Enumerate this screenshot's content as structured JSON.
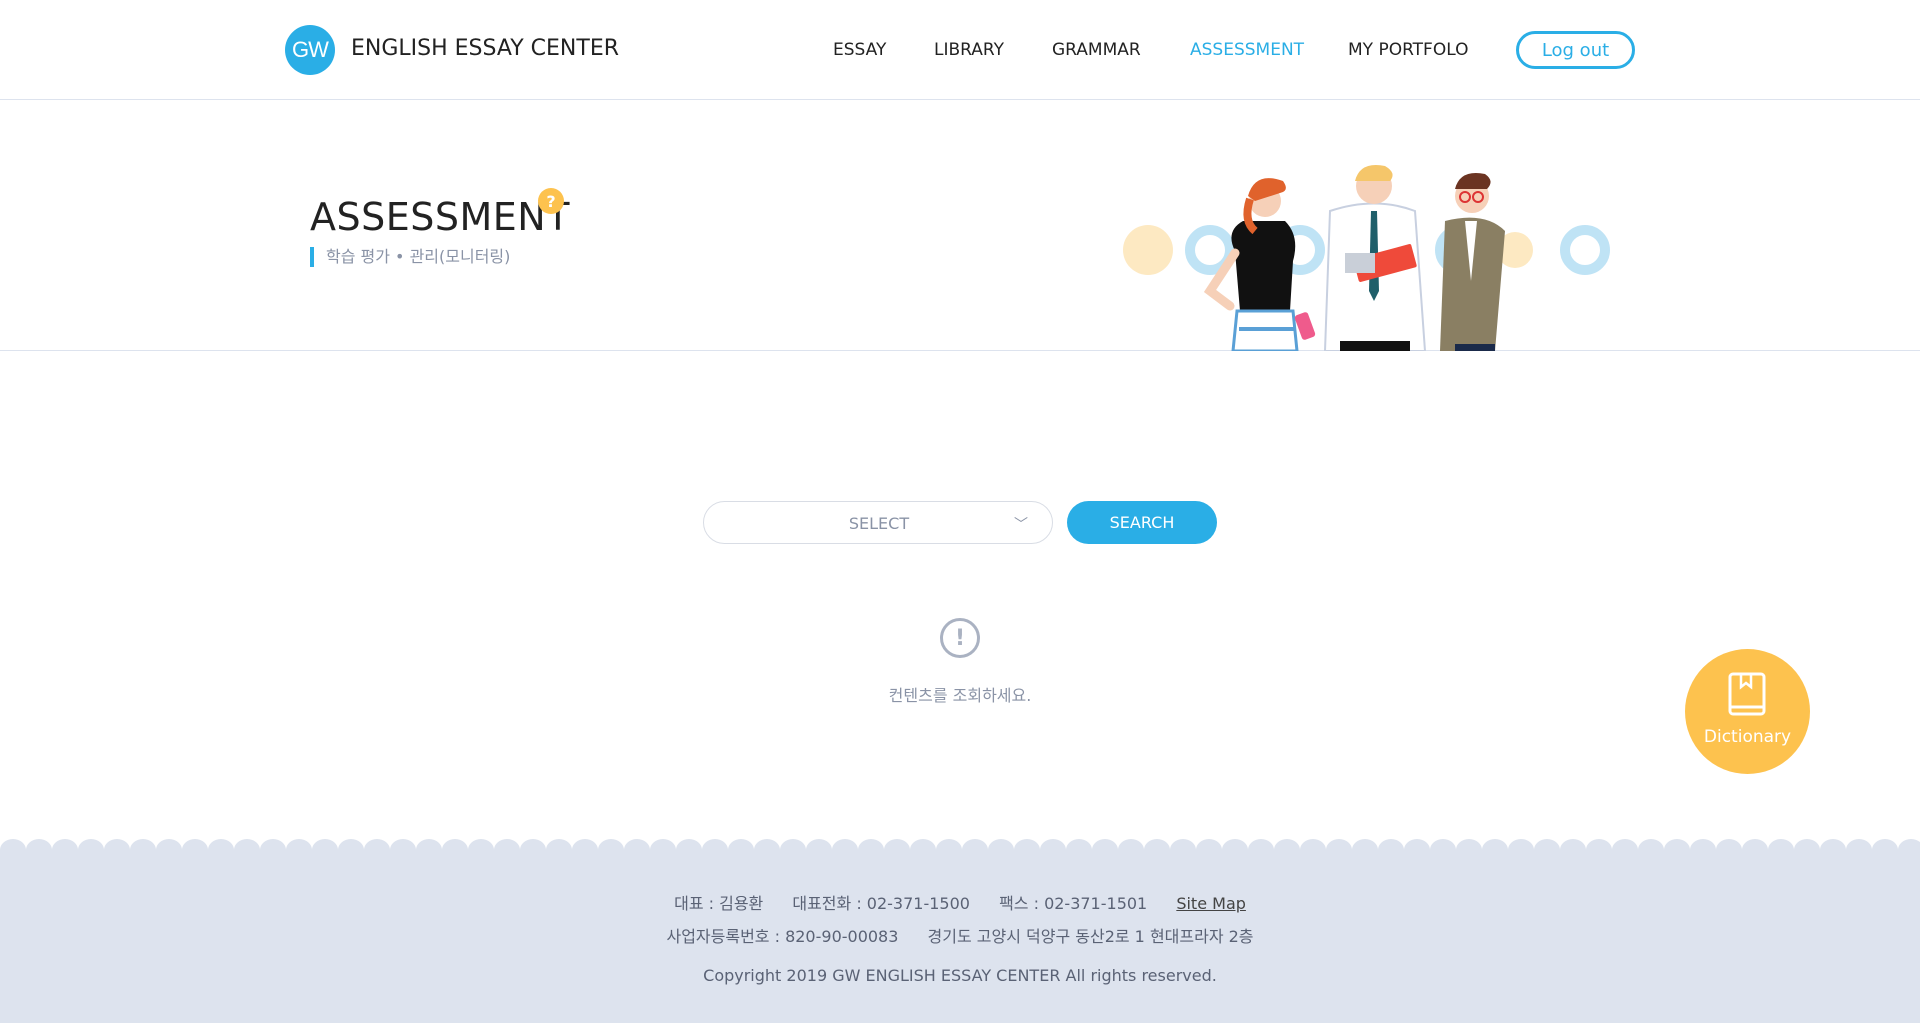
{
  "header": {
    "logo_text": "GW",
    "brand": "ENGLISH ESSAY CENTER",
    "nav": [
      {
        "label": "ESSAY",
        "active": false
      },
      {
        "label": "LIBRARY",
        "active": false
      },
      {
        "label": "GRAMMAR",
        "active": false
      },
      {
        "label": "ASSESSMENT",
        "active": true
      },
      {
        "label": "MY PORTFOLO",
        "active": false
      }
    ],
    "logout_label": "Log out"
  },
  "banner": {
    "title": "ASSESSMENT",
    "help_icon": "?",
    "subtitle": "학습 평가 • 관리(모니터링)"
  },
  "search": {
    "select_placeholder": "SELECT",
    "search_label": "SEARCH"
  },
  "empty_state": {
    "icon": "!",
    "message": "컨텐츠를 조회하세요."
  },
  "dictionary": {
    "label": "Dictionary"
  },
  "footer": {
    "rep": "대표 : 김용환",
    "phone": "대표전화 : 02-371-1500",
    "fax": "팩스 : 02-371-1501",
    "sitemap": "Site Map",
    "biz_no": "사업자등록번호 : 820-90-00083",
    "address": "경기도 고양시 덕양구 동산2로 1 현대프라자 2층",
    "copyright": "Copyright 2019 GW ENGLISH ESSAY CENTER All rights reserved."
  },
  "colors": {
    "accent": "#2aaee6",
    "yellow": "#fdc24e",
    "footer_bg": "#dde3ee"
  }
}
